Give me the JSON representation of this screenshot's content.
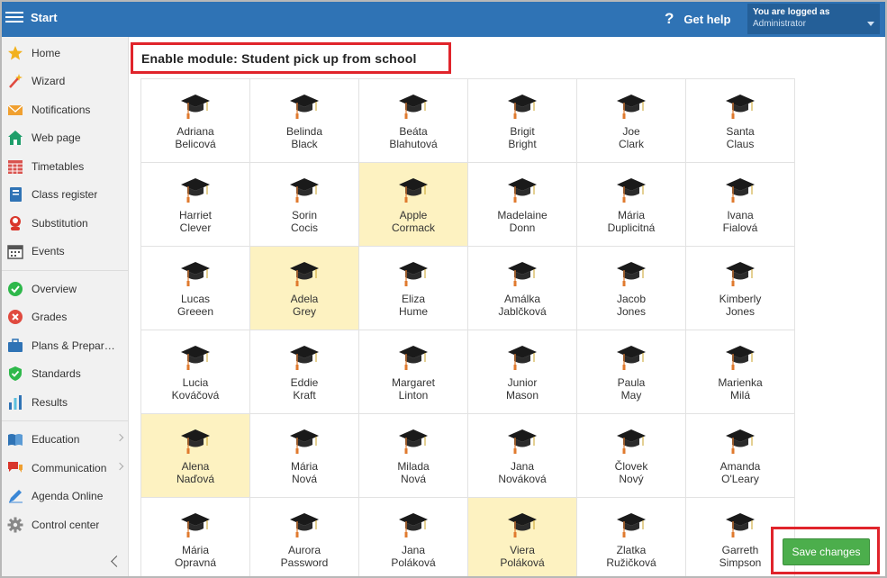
{
  "header": {
    "title": "Start",
    "help_label": "Get help",
    "help_glyph": "?",
    "user_status": "You are logged as",
    "user_role": "Administrator"
  },
  "sidebar": {
    "items": [
      {
        "label": "Home",
        "icon": "star-icon",
        "color": "#f2b11c"
      },
      {
        "label": "Wizard",
        "icon": "magic-wand-icon",
        "color": "#e04a3f"
      },
      {
        "label": "Notifications",
        "icon": "envelope-icon",
        "color": "#f0a030"
      },
      {
        "label": "Web page",
        "icon": "house-icon",
        "color": "#1e9e6a"
      },
      {
        "label": "Timetables",
        "icon": "calendar-grid-icon",
        "color": "#d9534f"
      },
      {
        "label": "Class register",
        "icon": "register-book-icon",
        "color": "#2f73b5"
      },
      {
        "label": "Substitution",
        "icon": "person-icon",
        "color": "#d9362b"
      },
      {
        "label": "Events",
        "icon": "calendar-icon",
        "color": "#555555"
      },
      {
        "label": "Overview",
        "icon": "check-circle-icon",
        "color": "#2eb84b"
      },
      {
        "label": "Grades",
        "icon": "cross-circle-icon",
        "color": "#e04a3f"
      },
      {
        "label": "Plans & Prepar…",
        "icon": "briefcase-icon",
        "color": "#2f73b5"
      },
      {
        "label": "Standards",
        "icon": "shield-check-icon",
        "color": "#2eb84b"
      },
      {
        "label": "Results",
        "icon": "bar-chart-icon",
        "color": "#2f73b5"
      },
      {
        "label": "Education",
        "icon": "book-icon",
        "color": "#2f73b5",
        "chevron": true
      },
      {
        "label": "Communication",
        "icon": "chat-bubbles-icon",
        "color": "#d9362b",
        "chevron": true
      },
      {
        "label": "Agenda Online",
        "icon": "pen-icon",
        "color": "#3a87d6"
      },
      {
        "label": "Control center",
        "icon": "gear-icon",
        "color": "#888888"
      }
    ]
  },
  "main": {
    "title": "Enable module: Student pick up from school",
    "save_label": "Save changes",
    "students": [
      {
        "first": "Adriana",
        "last": "Belicová",
        "selected": false
      },
      {
        "first": "Belinda",
        "last": "Black",
        "selected": false
      },
      {
        "first": "Beáta",
        "last": "Blahutová",
        "selected": false
      },
      {
        "first": "Brigit",
        "last": "Bright",
        "selected": false
      },
      {
        "first": "Joe",
        "last": "Clark",
        "selected": false
      },
      {
        "first": "Santa",
        "last": "Claus",
        "selected": false
      },
      {
        "first": "Harriet",
        "last": "Clever",
        "selected": false
      },
      {
        "first": "Sorin",
        "last": "Cocis",
        "selected": false
      },
      {
        "first": "Apple",
        "last": "Cormack",
        "selected": true
      },
      {
        "first": "Madelaine",
        "last": "Donn",
        "selected": false
      },
      {
        "first": "Mária",
        "last": "Duplicitná",
        "selected": false
      },
      {
        "first": "Ivana",
        "last": "Fialová",
        "selected": false
      },
      {
        "first": "Lucas",
        "last": "Greeen",
        "selected": false
      },
      {
        "first": "Adela",
        "last": "Grey",
        "selected": true
      },
      {
        "first": "Eliza",
        "last": "Hume",
        "selected": false
      },
      {
        "first": "Amálka",
        "last": "Jablčková",
        "selected": false
      },
      {
        "first": "Jacob",
        "last": "Jones",
        "selected": false
      },
      {
        "first": "Kimberly",
        "last": "Jones",
        "selected": false
      },
      {
        "first": "Lucia",
        "last": "Kováčová",
        "selected": false
      },
      {
        "first": "Eddie",
        "last": "Kraft",
        "selected": false
      },
      {
        "first": "Margaret",
        "last": "Linton",
        "selected": false
      },
      {
        "first": "Junior",
        "last": "Mason",
        "selected": false
      },
      {
        "first": "Paula",
        "last": "May",
        "selected": false
      },
      {
        "first": "Marienka",
        "last": "Milá",
        "selected": false
      },
      {
        "first": "Alena",
        "last": "Naďová",
        "selected": true
      },
      {
        "first": "Mária",
        "last": "Nová",
        "selected": false
      },
      {
        "first": "Milada",
        "last": "Nová",
        "selected": false
      },
      {
        "first": "Jana",
        "last": "Nováková",
        "selected": false
      },
      {
        "first": "Človek",
        "last": "Nový",
        "selected": false
      },
      {
        "first": "Amanda",
        "last": "O'Leary",
        "selected": false
      },
      {
        "first": "Mária",
        "last": "Opravná",
        "selected": false
      },
      {
        "first": "Aurora",
        "last": "Password",
        "selected": false
      },
      {
        "first": "Jana",
        "last": "Poláková",
        "selected": false
      },
      {
        "first": "Viera",
        "last": "Poláková",
        "selected": true
      },
      {
        "first": "Zlatka",
        "last": "Ružičková",
        "selected": false
      },
      {
        "first": "Garreth",
        "last": "Simpson",
        "selected": false
      }
    ]
  },
  "colors": {
    "header": "#2f73b5",
    "selected_tile": "#fdf2c1",
    "highlight_border": "#e0242b",
    "save_button": "#4cae4c"
  }
}
